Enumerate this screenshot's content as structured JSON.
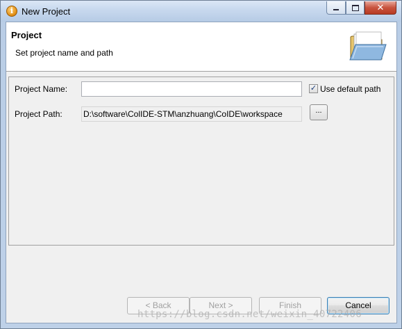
{
  "window": {
    "title": "New Project",
    "close_glyph": "✕",
    "info_glyph": "i"
  },
  "header": {
    "title": "Project",
    "description": "Set project name and path"
  },
  "form": {
    "project_name_label": "Project Name:",
    "project_name_value": "",
    "use_default_path_label": "Use default path",
    "use_default_path_checked": true,
    "checkmark": "✓",
    "project_path_label": "Project Path:",
    "project_path_value": "D:\\software\\ColIDE-STM\\anzhuang\\CoIDE\\workspace",
    "browse_label": "..."
  },
  "footer": {
    "back_label": "< Back",
    "next_label": "Next >",
    "finish_label": "Finish",
    "cancel_label": "Cancel"
  },
  "watermark": "https://blog.csdn.net/weixin_40722406"
}
